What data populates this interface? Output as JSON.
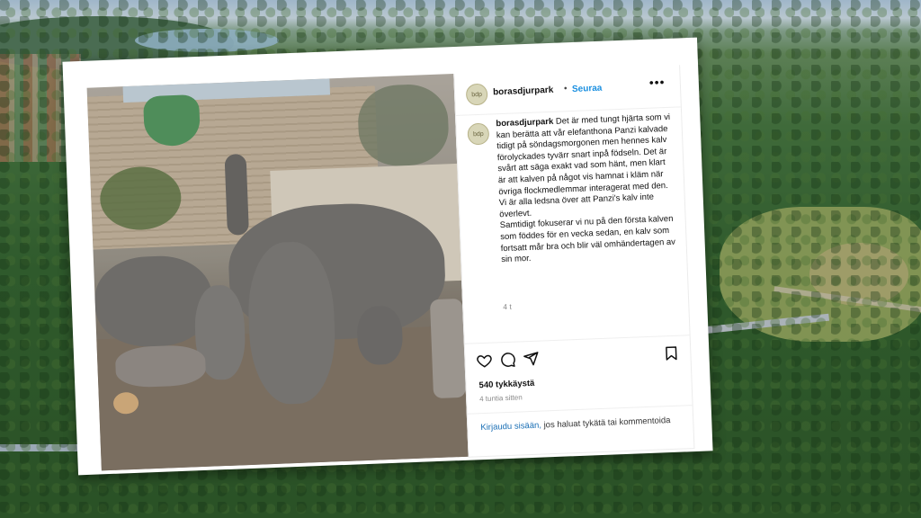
{
  "post": {
    "username": "borasdjurpark",
    "separator": "•",
    "follow_label": "Seuraa",
    "more_label": "•••",
    "avatar_text": "bdp",
    "caption_username": "borasdjurpark",
    "caption_text": "Det är med tungt hjärta som vi kan berätta att vår elefanthona Panzi kalvade tidigt på söndagsmorgonen men hennes kalv förolyckades tyvärr snart inpå födseln. Det är svårt att säga exakt vad som hänt, men klart är att kalven på något vis hamnat i kläm när övriga flockmedlemmar interagerat med den. Vi är alla ledsna över att Panzi's kalv inte överlevt.",
    "caption_text_2": "Samtidigt fokuserar vi nu på den första kalven som föddes för en vecka sedan, en kalv som fortsatt mår bra och blir väl omhändertagen av sin mor.",
    "caption_time": "4 t",
    "likes": "540 tykkäystä",
    "posted_ago": "4 tuntia sitten",
    "login_link": "Kirjaudu sisään,",
    "login_rest": " jos haluat tykätä tai kommentoida"
  },
  "icons": [
    "heart-icon",
    "comment-icon",
    "share-icon",
    "bookmark-icon",
    "more-icon"
  ],
  "colors": {
    "follow": "#1a8fe0",
    "link": "#1a6fb5",
    "card_bg": "#ffffff"
  }
}
